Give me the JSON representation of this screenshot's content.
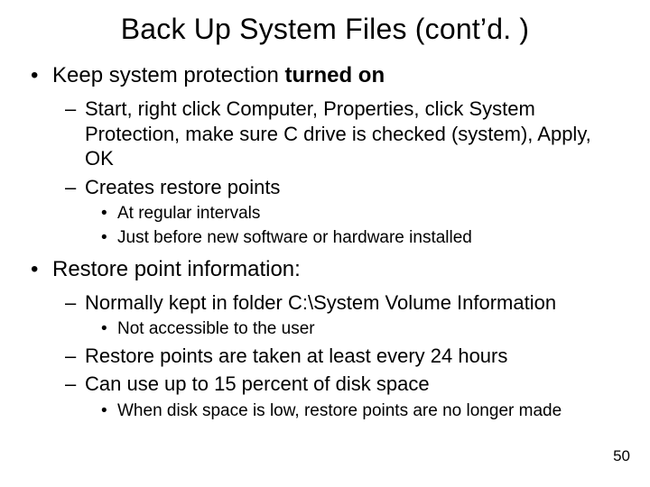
{
  "title": "Back Up System Files (cont’d. )",
  "items": [
    {
      "prefix": "Keep system protection ",
      "bold": "turned on",
      "suffix": "",
      "children": [
        {
          "text": "Start, right click Computer, Properties, click System Protection, make sure C drive is checked (system), Apply, OK"
        },
        {
          "text": "Creates restore points",
          "children": [
            {
              "text": "At regular intervals"
            },
            {
              "text": "Just before new software or hardware installed"
            }
          ]
        }
      ]
    },
    {
      "text": "Restore point information:",
      "children": [
        {
          "text": "Normally kept in folder C:\\System Volume Information",
          "children": [
            {
              "text": "Not accessible to the user"
            }
          ]
        },
        {
          "text": "Restore points are taken at least every 24 hours"
        },
        {
          "text": "Can use up to 15 percent of disk space",
          "children": [
            {
              "text": "When disk space is low, restore points are no longer made"
            }
          ]
        }
      ]
    }
  ],
  "page_number": "50"
}
